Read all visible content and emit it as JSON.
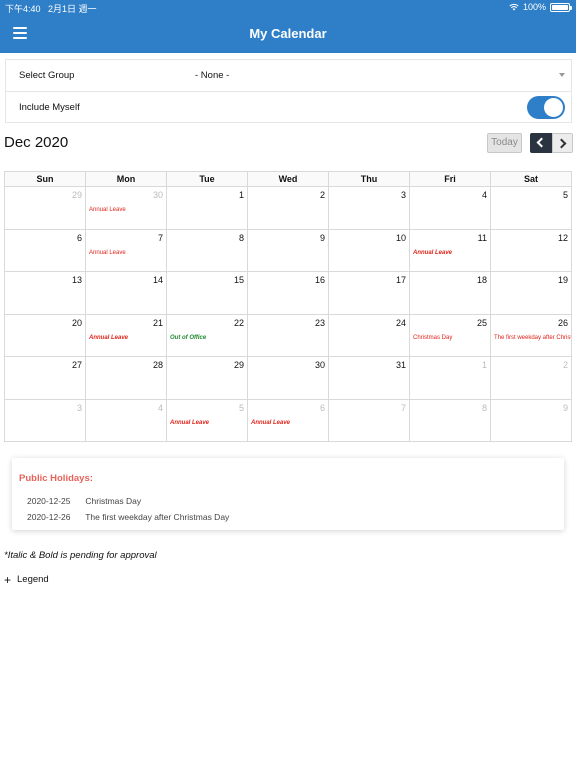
{
  "status_bar": {
    "time": "下午4:40",
    "date": "2月1日 週一",
    "battery": "100%"
  },
  "header": {
    "title": "My Calendar"
  },
  "form": {
    "group_label": "Select Group",
    "group_value": "- None -",
    "include_label": "Include Myself",
    "include_on": true
  },
  "calendar": {
    "month_title": "Dec 2020",
    "today_label": "Today",
    "weekdays": [
      "Sun",
      "Mon",
      "Tue",
      "Wed",
      "Thu",
      "Fri",
      "Sat"
    ],
    "weeks": [
      [
        {
          "n": "29",
          "other": true
        },
        {
          "n": "30",
          "other": true,
          "event": "Annual Leave",
          "style": "normal"
        },
        {
          "n": "1"
        },
        {
          "n": "2"
        },
        {
          "n": "3"
        },
        {
          "n": "4"
        },
        {
          "n": "5"
        }
      ],
      [
        {
          "n": "6"
        },
        {
          "n": "7",
          "event": "Annual Leave",
          "style": "normal"
        },
        {
          "n": "8"
        },
        {
          "n": "9"
        },
        {
          "n": "10"
        },
        {
          "n": "11",
          "event": "Annual Leave",
          "style": "pending"
        },
        {
          "n": "12"
        }
      ],
      [
        {
          "n": "13"
        },
        {
          "n": "14"
        },
        {
          "n": "15"
        },
        {
          "n": "16"
        },
        {
          "n": "17"
        },
        {
          "n": "18"
        },
        {
          "n": "19"
        }
      ],
      [
        {
          "n": "20"
        },
        {
          "n": "21",
          "event": "Annual Leave",
          "style": "pending"
        },
        {
          "n": "22",
          "event": "Out of Office",
          "style": "pending-green"
        },
        {
          "n": "23"
        },
        {
          "n": "24"
        },
        {
          "n": "25",
          "event": "Christmas Day",
          "style": "normal"
        },
        {
          "n": "26",
          "event": "The first weekday after Christmas Day",
          "style": "normal"
        }
      ],
      [
        {
          "n": "27"
        },
        {
          "n": "28"
        },
        {
          "n": "29"
        },
        {
          "n": "30"
        },
        {
          "n": "31"
        },
        {
          "n": "1",
          "other": true
        },
        {
          "n": "2",
          "other": true
        }
      ],
      [
        {
          "n": "3",
          "other": true
        },
        {
          "n": "4",
          "other": true
        },
        {
          "n": "5",
          "other": true,
          "event": "Annual Leave",
          "style": "pending"
        },
        {
          "n": "6",
          "other": true,
          "event": "Annual Leave",
          "style": "pending"
        },
        {
          "n": "7",
          "other": true
        },
        {
          "n": "8",
          "other": true
        },
        {
          "n": "9",
          "other": true
        }
      ]
    ]
  },
  "holidays": {
    "title": "Public Holidays:",
    "items": [
      {
        "date": "2020-12-25",
        "name": "Christmas Day"
      },
      {
        "date": "2020-12-26",
        "name": "The first weekday after Christmas Day"
      }
    ]
  },
  "note": "*Italic & Bold is pending for approval",
  "legend": {
    "label": "Legend"
  },
  "colors": {
    "primary": "#2f7fc8",
    "event_red": "#e0241b",
    "event_green": "#1e8a2e",
    "holiday_title": "#e8635a"
  }
}
